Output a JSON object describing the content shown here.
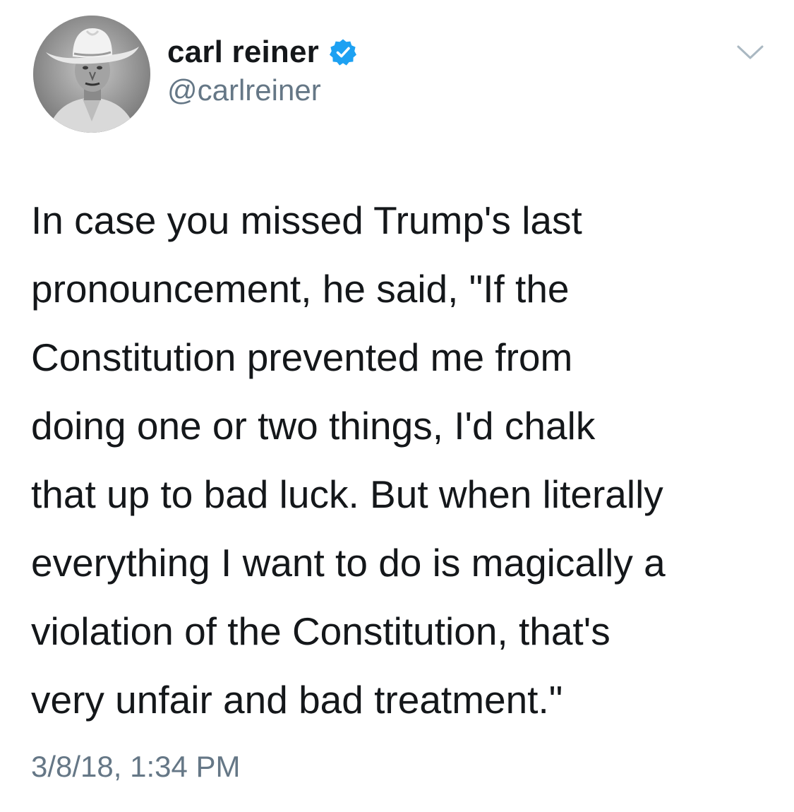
{
  "user": {
    "display_name": "carl reiner",
    "handle": "@carlreiner",
    "verified_icon": "verified-badge-icon",
    "avatar_icon": "profile-photo"
  },
  "tweet": {
    "lines": [
      "In case you missed Trump's last",
      "pronouncement, he said, \"If the",
      "Constitution prevented me from",
      "doing one or two things, I'd chalk",
      "that up to bad luck. But when literally",
      "everything I want to do is magically a",
      "violation of the Constitution, that's",
      "very unfair and bad treatment.\""
    ],
    "timestamp": "3/8/18, 1:34 PM"
  },
  "menu": {
    "icon": "chevron-down-icon"
  },
  "colors": {
    "text": "#14171a",
    "secondary": "#657786",
    "verified": "#1da1f2",
    "chevron": "#aab8c2"
  }
}
